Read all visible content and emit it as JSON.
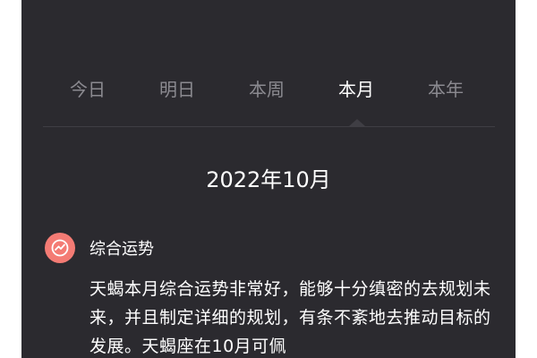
{
  "tabs": [
    {
      "label": "今日",
      "active": false
    },
    {
      "label": "明日",
      "active": false
    },
    {
      "label": "本周",
      "active": false
    },
    {
      "label": "本月",
      "active": true
    },
    {
      "label": "本年",
      "active": false
    }
  ],
  "date_title": "2022年10月",
  "section": {
    "icon": "trend-chart-icon",
    "title": "综合运势",
    "paragraph": "天蝎本月综合运势非常好，能够十分缜密的去规划未来，并且制定详细的规划，有条不紊地去推动目标的发展。天蝎座在10月可佩"
  },
  "colors": {
    "background": "#2b2a2f",
    "inactive_tab": "#8b8a90",
    "active_text": "#ffffff",
    "icon_bg": "#f47b74"
  }
}
